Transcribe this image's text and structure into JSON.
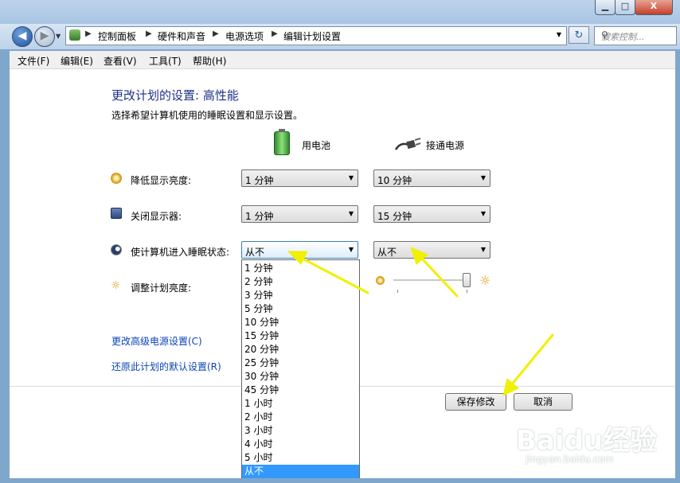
{
  "window": {
    "minimize_label": "▁",
    "maximize_label": "□",
    "close_label": "X"
  },
  "nav": {
    "back_icon": "back-arrow-icon",
    "forward_icon": "forward-arrow-icon",
    "breadcrumb": [
      "控制面板",
      "硬件和声音",
      "电源选项",
      "编辑计划设置"
    ],
    "search_placeholder": "搜索控制...",
    "refresh_icon": "refresh-icon"
  },
  "menubar": [
    "文件(F)",
    "编辑(E)",
    "查看(V)",
    "工具(T)",
    "帮助(H)"
  ],
  "page": {
    "title": "更改计划的设置: 高性能",
    "subtitle": "选择希望计算机使用的睡眠设置和显示设置。",
    "col_battery": "用电池",
    "col_plugged": "接通电源"
  },
  "settings": [
    {
      "label": "降低显示亮度:",
      "battery": "1 分钟",
      "plugged": "10 分钟"
    },
    {
      "label": "关闭显示器:",
      "battery": "1 分钟",
      "plugged": "15 分钟"
    },
    {
      "label": "使计算机进入睡眠状态:",
      "battery": "从不",
      "plugged": "从不"
    },
    {
      "label": "调整计划亮度:"
    }
  ],
  "brightness": {
    "plugged_level": 0.96
  },
  "dropdown_options": [
    "1 分钟",
    "2 分钟",
    "3 分钟",
    "5 分钟",
    "10 分钟",
    "15 分钟",
    "20 分钟",
    "25 分钟",
    "30 分钟",
    "45 分钟",
    "1 小时",
    "2 小时",
    "3 小时",
    "4 小时",
    "5 小时",
    "从不"
  ],
  "dropdown_selected": "从不",
  "links": {
    "advanced": "更改高级电源设置(C)",
    "restore": "还原此计划的默认设置(R)"
  },
  "buttons": {
    "save": "保存修改",
    "cancel": "取消"
  },
  "watermark": {
    "logo": "Baidu经验",
    "url": "jingyan.baidu.com"
  },
  "colors": {
    "arrow": "#f0f000",
    "link": "#0a44b8",
    "heading": "#1e3287",
    "selection": "#3399ff"
  }
}
